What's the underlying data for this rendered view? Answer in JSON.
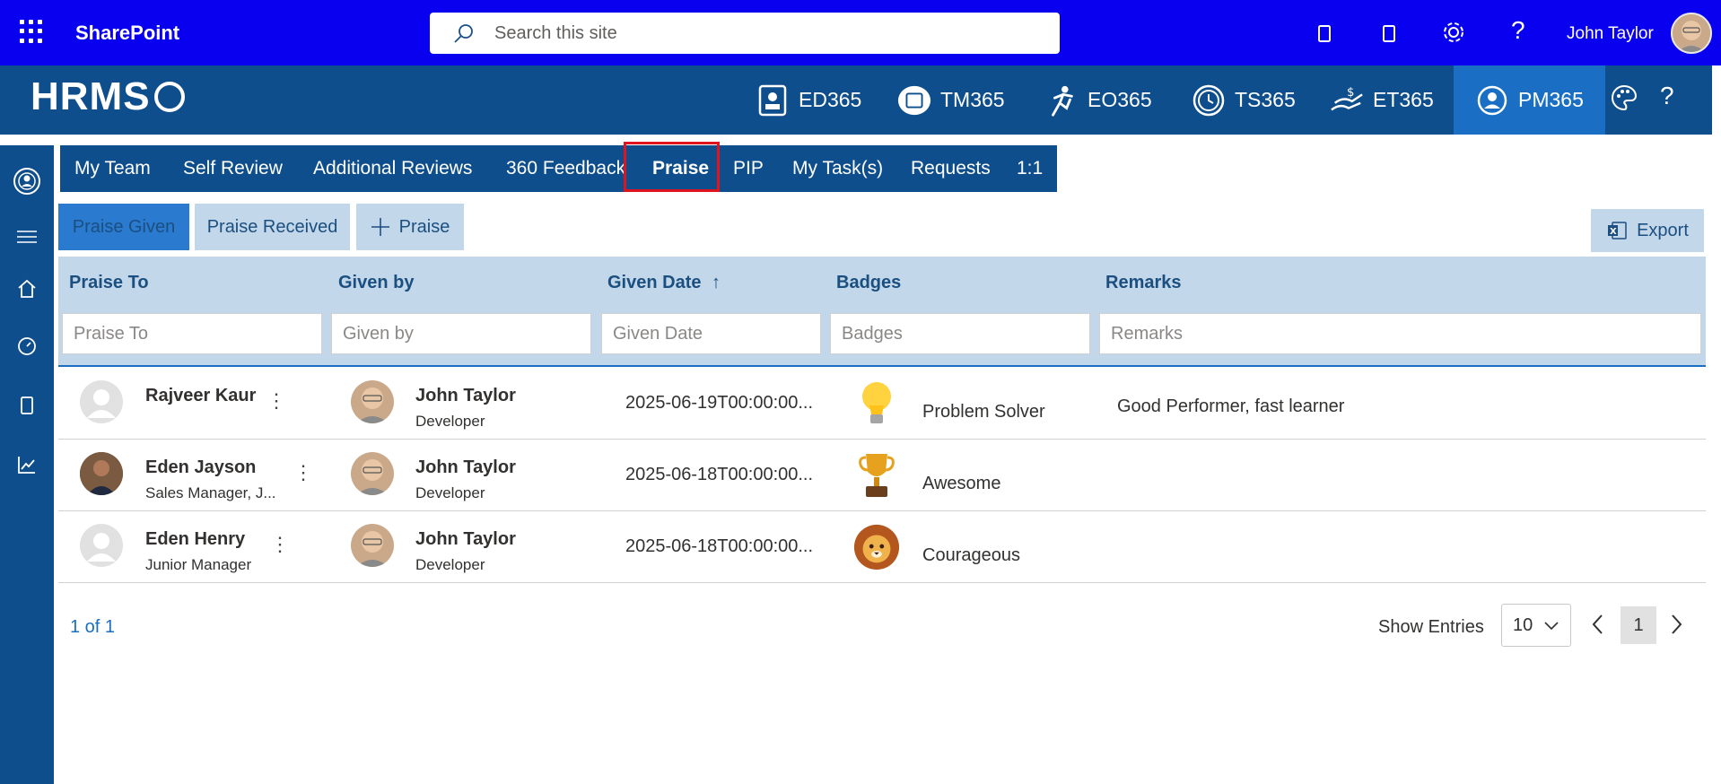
{
  "suitebar": {
    "app_title": "SharePoint",
    "search_placeholder": "Search this site",
    "user_name": "John Taylor"
  },
  "hrms": {
    "logo": "HRMS",
    "apps": [
      {
        "label": "ED365",
        "icon": "id-card-icon"
      },
      {
        "label": "TM365",
        "icon": "calendar-blob-icon"
      },
      {
        "label": "EO365",
        "icon": "running-person-icon"
      },
      {
        "label": "TS365",
        "icon": "clock-icon"
      },
      {
        "label": "ET365",
        "icon": "money-hand-icon"
      },
      {
        "label": "PM365",
        "icon": "person-circle-icon"
      }
    ]
  },
  "modnav": {
    "items": [
      "My Team",
      "Self Review",
      "Additional Reviews",
      "360 Feedback",
      "Praise",
      "PIP",
      "My Task(s)",
      "Requests",
      "1:1"
    ],
    "selected": "Praise"
  },
  "subtabs": {
    "given": "Praise Given",
    "received": "Praise Received",
    "add": "Praise",
    "export": "Export"
  },
  "table": {
    "headers": [
      "Praise To",
      "Given by",
      "Given Date",
      "Badges",
      "Remarks"
    ],
    "sort_arrow": "↑",
    "filters": [
      "Praise To",
      "Given by",
      "Given Date",
      "Badges",
      "Remarks"
    ],
    "rows": [
      {
        "to_name": "Rajveer Kaur",
        "to_role": "",
        "by_name": "John Taylor",
        "by_role": "Developer",
        "date": "2025-06-19T00:00:00...",
        "badge": "Problem Solver",
        "badge_icon": "lightbulb-icon",
        "remarks": "Good Performer, fast learner"
      },
      {
        "to_name": "Eden Jayson",
        "to_role": "Sales Manager, J...",
        "by_name": "John Taylor",
        "by_role": "Developer",
        "date": "2025-06-18T00:00:00...",
        "badge": "Awesome",
        "badge_icon": "trophy-icon",
        "remarks": ""
      },
      {
        "to_name": "Eden Henry",
        "to_role": "Junior Manager",
        "by_name": "John Taylor",
        "by_role": "Developer",
        "date": "2025-06-18T00:00:00...",
        "badge": "Courageous",
        "badge_icon": "lion-icon",
        "remarks": ""
      }
    ]
  },
  "pager": {
    "info": "1 of 1",
    "show_entries_label": "Show Entries",
    "entries_value": "10",
    "current_page": "1"
  },
  "colors": {
    "suitebar": "#0a00f0",
    "brand": "#0f4e8c",
    "active_app": "#1a6fc4",
    "selection": "#e0141e"
  }
}
